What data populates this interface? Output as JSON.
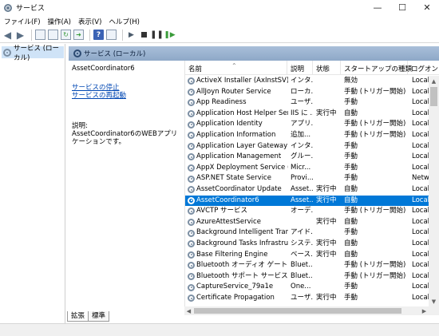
{
  "window": {
    "title": "サービス",
    "minimize": "—",
    "maximize": "☐",
    "close": "✕"
  },
  "menu": [
    "ファイル(F)",
    "操作(A)",
    "表示(V)",
    "ヘルプ(H)"
  ],
  "toolbar": {
    "help_label": "?"
  },
  "tree": {
    "root_label": "サービス (ローカル)"
  },
  "pane": {
    "header": "サービス (ローカル)",
    "selected_service": "AssetCoordinator6",
    "link_stop": "サービスの停止",
    "link_restart": "サービスの再起動",
    "desc_label": "説明:",
    "desc_text": "AssetCoordinator6のWEBアプリケーションです。"
  },
  "columns": {
    "name": "名前",
    "description": "説明",
    "status": "状態",
    "startup": "スタートアップの種類",
    "logon": "ログオン"
  },
  "services": [
    {
      "name": "ActiveX Installer (AxInstSV)",
      "description": "インタ...",
      "status": "",
      "startup": "無効",
      "logon": "Local S"
    },
    {
      "name": "AllJoyn Router Service",
      "description": "ローカ...",
      "status": "",
      "startup": "手動 (トリガー開始)",
      "logon": "Local S"
    },
    {
      "name": "App Readiness",
      "description": "ユーザ...",
      "status": "",
      "startup": "手動",
      "logon": "Local S"
    },
    {
      "name": "Application Host Helper Ser...",
      "description": "IIS に ...",
      "status": "実行中",
      "startup": "自動",
      "logon": "Local S"
    },
    {
      "name": "Application Identity",
      "description": "アプリ...",
      "status": "",
      "startup": "手動 (トリガー開始)",
      "logon": "Local S"
    },
    {
      "name": "Application Information",
      "description": "追加...",
      "status": "",
      "startup": "手動 (トリガー開始)",
      "logon": "Local S"
    },
    {
      "name": "Application Layer Gateway ...",
      "description": "インタ...",
      "status": "",
      "startup": "手動",
      "logon": "Local S"
    },
    {
      "name": "Application Management",
      "description": "グルー...",
      "status": "",
      "startup": "手動",
      "logon": "Local S"
    },
    {
      "name": "AppX Deployment Service (...",
      "description": "Micr...",
      "status": "",
      "startup": "手動",
      "logon": "Local S"
    },
    {
      "name": "ASP.NET State Service",
      "description": "Provi...",
      "status": "",
      "startup": "手動",
      "logon": "Networ"
    },
    {
      "name": "AssetCoordinator Update",
      "description": "Asset...",
      "status": "実行中",
      "startup": "自動",
      "logon": "Local S"
    },
    {
      "name": "AssetCoordinator6",
      "description": "Asset...",
      "status": "実行中",
      "startup": "自動",
      "logon": "Local S"
    },
    {
      "name": "AVCTP サービス",
      "description": "オーデ...",
      "status": "",
      "startup": "手動 (トリガー開始)",
      "logon": "Local S"
    },
    {
      "name": "AzureAttestService",
      "description": "",
      "status": "実行中",
      "startup": "自動",
      "logon": "Local S"
    },
    {
      "name": "Background Intelligent Tran...",
      "description": "アイド...",
      "status": "",
      "startup": "手動",
      "logon": "Local S"
    },
    {
      "name": "Background Tasks Infrastruc...",
      "description": "システ...",
      "status": "実行中",
      "startup": "自動",
      "logon": "Local S"
    },
    {
      "name": "Base Filtering Engine",
      "description": "ベース...",
      "status": "実行中",
      "startup": "自動",
      "logon": "Local S"
    },
    {
      "name": "Bluetooth オーディオ ゲートウェ...",
      "description": "Bluet...",
      "status": "",
      "startup": "手動 (トリガー開始)",
      "logon": "Local S"
    },
    {
      "name": "Bluetooth サポート サービス",
      "description": "Bluet...",
      "status": "",
      "startup": "手動 (トリガー開始)",
      "logon": "Local S"
    },
    {
      "name": "CaptureService_79a1e",
      "description": "One...",
      "status": "",
      "startup": "手動",
      "logon": "Local S"
    },
    {
      "name": "Certificate Propagation",
      "description": "ユーザ...",
      "status": "実行中",
      "startup": "手動",
      "logon": "Local S"
    }
  ],
  "selected_index": 11,
  "tabs": [
    "拡張",
    "標準"
  ],
  "active_tab": "拡張"
}
